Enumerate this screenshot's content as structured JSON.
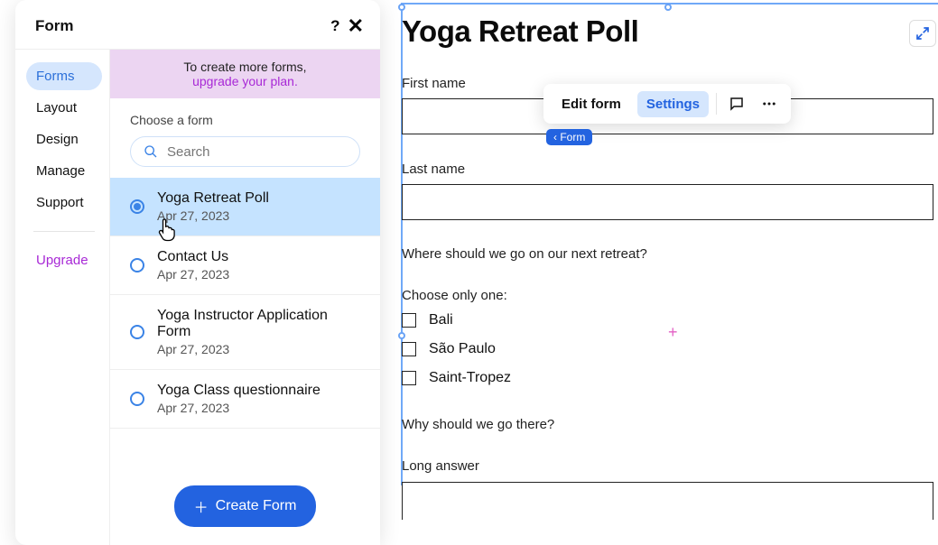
{
  "panel": {
    "title": "Form",
    "sidebar": {
      "items": [
        {
          "label": "Forms",
          "active": true
        },
        {
          "label": "Layout",
          "active": false
        },
        {
          "label": "Design",
          "active": false
        },
        {
          "label": "Manage",
          "active": false
        },
        {
          "label": "Support",
          "active": false
        }
      ],
      "upgrade_label": "Upgrade"
    },
    "banner": {
      "line1": "To create more forms,",
      "line2": "upgrade your plan."
    },
    "choose_label": "Choose a form",
    "search_placeholder": "Search",
    "forms": [
      {
        "name": "Yoga Retreat Poll",
        "date": "Apr 27, 2023",
        "selected": true
      },
      {
        "name": "Contact Us",
        "date": "Apr 27, 2023",
        "selected": false
      },
      {
        "name": "Yoga Instructor Application Form",
        "date": "Apr 27, 2023",
        "selected": false
      },
      {
        "name": "Yoga Class questionnaire",
        "date": "Apr 27, 2023",
        "selected": false
      }
    ],
    "create_button": "Create Form"
  },
  "canvas": {
    "title": "Yoga Retreat Poll",
    "first_name_label": "First name",
    "last_name_label": "Last name",
    "question1": "Where should we go on our next retreat?",
    "choose_one": "Choose only one:",
    "options": [
      "Bali",
      "São Paulo",
      "Saint-Tropez"
    ],
    "question2": "Why should we go there?",
    "long_answer_label": "Long answer",
    "tag": "‹ Form"
  },
  "toolbar": {
    "edit": "Edit form",
    "settings": "Settings"
  }
}
